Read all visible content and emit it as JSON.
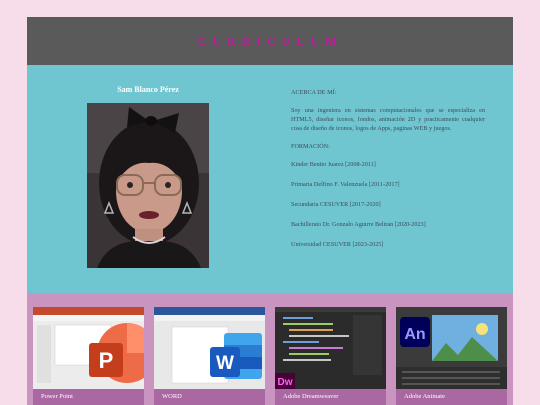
{
  "header": {
    "title": "CURRICULUM"
  },
  "profile": {
    "name": "Sam Blanco Pérez",
    "photo_alt": "profile photo"
  },
  "about": {
    "label": "ACERCA DE MÍ:",
    "text": "Soy una ingeniera en sistemas computacionales que se especializa en HTML5, diseñar iconos, fondos, animación 2D y practicamente cualquier cosa de diseño de iconos, logos de Apps, paginas WEB y juegos."
  },
  "education": {
    "label": "FORMACIÓN:",
    "items": [
      "Kinder Benito Juarez [2008-2011]",
      "Primaria Delfino F. Valenzuela [2011-2017]",
      "Secundaria CESUVER [2017-2020]",
      "Bachillerato Dr. Gonzalo Aguirre Beltran [2020-2023]",
      "Universidad CESUVER [2023-2025]"
    ]
  },
  "skills": [
    {
      "label": "Power Point",
      "icon": "powerpoint-icon"
    },
    {
      "label": "WORD",
      "icon": "word-icon"
    },
    {
      "label": "Adobe Dreamweaver",
      "icon": "dreamweaver-icon"
    },
    {
      "label": "Adobe Animate",
      "icon": "animate-icon"
    }
  ],
  "colors": {
    "background": "#f6dde9",
    "header": "#5a5a5a",
    "title": "#c2189b",
    "main": "#6fc6d1",
    "skills": "#c994c0",
    "card": "#a968a2"
  }
}
